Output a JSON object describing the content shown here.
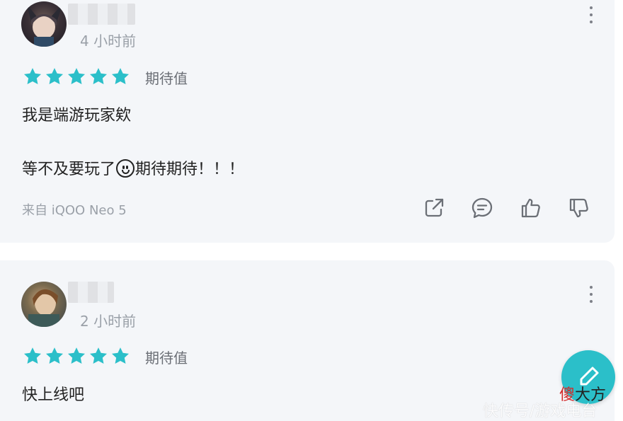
{
  "colors": {
    "star": "#2bbfc9",
    "card_bg": "#f4f6f9",
    "fab": "#2bbfc9",
    "secondary_text": "#9aa0a8"
  },
  "comments": [
    {
      "time": "4 小时前",
      "rating": 5,
      "rating_label": "期待值",
      "text_line1": "我是端游玩家欸",
      "text_line2_before": "等不及要玩了",
      "text_line2_emoji": "grinning-face-icon",
      "text_line2_after": "期待期待！！！",
      "device": "来自 iQOO Neo 5",
      "actions": [
        "share-icon",
        "comment-icon",
        "thumbs-up-icon",
        "thumbs-down-icon"
      ]
    },
    {
      "time": "2 小时前",
      "rating": 5,
      "rating_label": "期待值",
      "text_line1": "快上线吧"
    }
  ],
  "fab": {
    "icon": "pencil-icon"
  },
  "watermark": {
    "logo_red": "傻",
    "logo_black": "大方",
    "text": "快传号/游戏电台"
  }
}
